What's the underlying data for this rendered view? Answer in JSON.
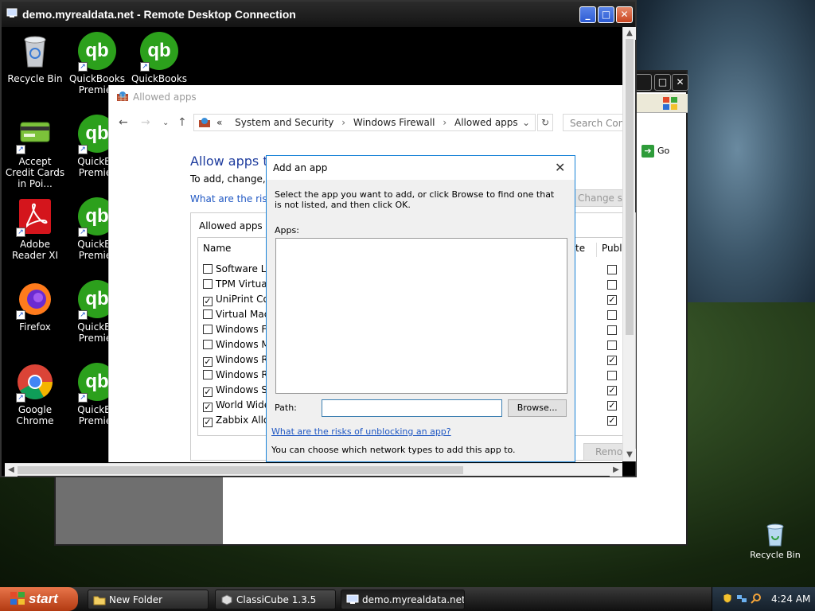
{
  "rdp": {
    "title": "demo.myrealdata.net - Remote Desktop Connection"
  },
  "desktop": {
    "icons": [
      {
        "label": "Recycle Bin"
      },
      {
        "label": "QuickBooks Premier"
      },
      {
        "label": "QuickBooks"
      },
      {
        "label": "Accept Credit Cards in Poi..."
      },
      {
        "label": "QuickBo Premier"
      },
      {
        "label": "Adobe Reader XI"
      },
      {
        "label": "QuickBo Premier"
      },
      {
        "label": "Firefox"
      },
      {
        "label": "QuickBo Premier"
      },
      {
        "label": "Google Chrome"
      },
      {
        "label": "QuickBo Premier"
      }
    ]
  },
  "control_panel": {
    "title": "Allowed apps",
    "breadcrumb": [
      "«",
      "System and Security",
      "Windows Firewall",
      "Allowed apps"
    ],
    "search_placeholder": "Search Contr",
    "heading": "Allow apps to",
    "subtext": "To add, change, or",
    "risks_link": "What are the risks",
    "change_settings": "Change set",
    "allowed_label": "Allowed apps an",
    "columns": {
      "name": "Name",
      "te": "te",
      "public": "Public"
    },
    "apps": [
      {
        "name": "Software Loa",
        "checked": false,
        "public": false
      },
      {
        "name": "TPM Virtual",
        "checked": false,
        "public": false
      },
      {
        "name": "UniPrint Cor",
        "checked": true,
        "public": true
      },
      {
        "name": "Virtual Mach",
        "checked": false,
        "public": false
      },
      {
        "name": "Windows Fir",
        "checked": false,
        "public": false
      },
      {
        "name": "Windows M",
        "checked": false,
        "public": false
      },
      {
        "name": "Windows Re",
        "checked": true,
        "public": true
      },
      {
        "name": "Windows Re",
        "checked": false,
        "public": false
      },
      {
        "name": "Windows Sh",
        "checked": true,
        "public": true
      },
      {
        "name": "World Wide",
        "checked": true,
        "public": true
      },
      {
        "name": "Zabbix Allov",
        "checked": true,
        "public": true
      }
    ],
    "remove_label": "Remo"
  },
  "dialog": {
    "title": "Add an app",
    "instructions": "Select the app you want to add, or click Browse to find one that is not listed, and then click OK.",
    "apps_label": "Apps:",
    "path_label": "Path:",
    "path_value": "",
    "browse_label": "Browse...",
    "risks_link": "What are the risks of unblocking an app?",
    "network_text": "You can choose which network types to add this app to."
  },
  "bg_window": {
    "go_label": "Go"
  },
  "real_desktop": {
    "recycle_bin": "Recycle Bin"
  },
  "taskbar": {
    "start_label": "start",
    "tasks": [
      {
        "label": "New Folder"
      },
      {
        "label": "ClassiCube 1.3.5"
      },
      {
        "label": "demo.myrealdata.net..."
      }
    ],
    "clock": "4:24 AM"
  },
  "colors": {
    "accent": "#1e3c9e",
    "link": "#1f57c3",
    "dialog_border": "#1883d7",
    "quickbooks": "#2ca01c"
  }
}
